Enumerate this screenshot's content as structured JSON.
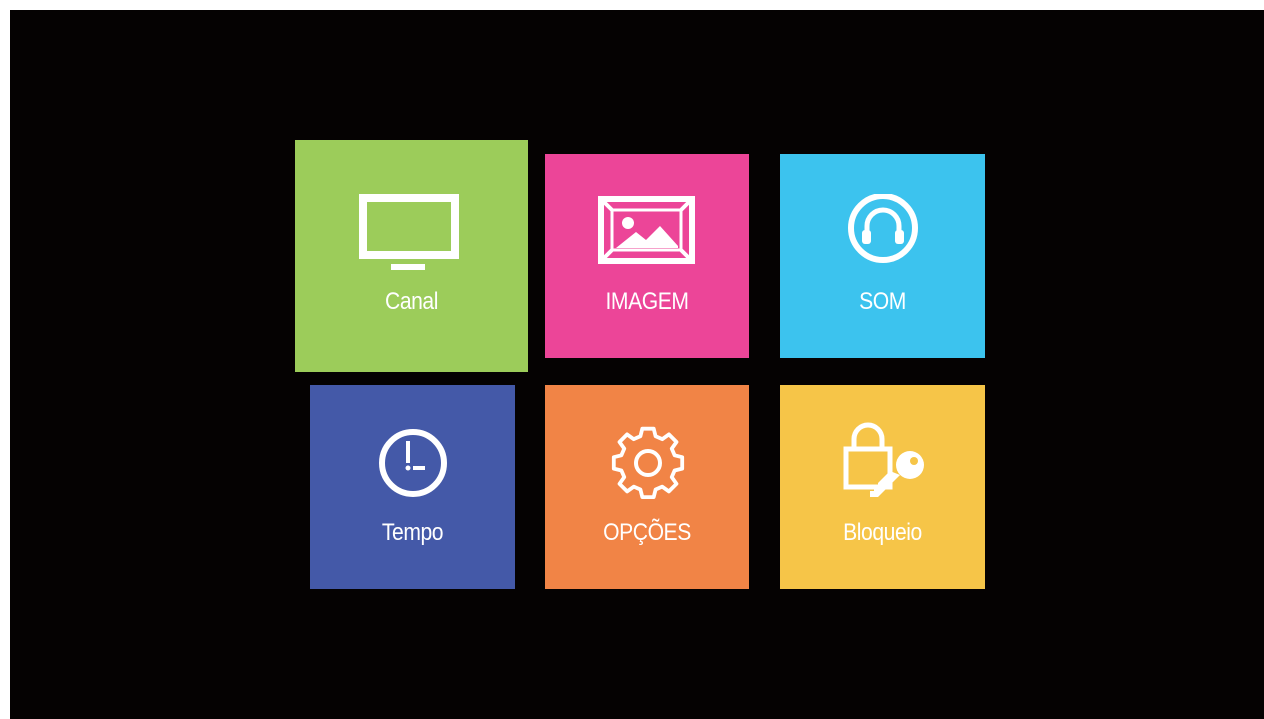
{
  "menu": {
    "tiles": [
      {
        "label": "Canal",
        "icon": "tv-icon",
        "color": "#9ccc5a"
      },
      {
        "label": "IMAGEM",
        "icon": "image-icon",
        "color": "#ec4598"
      },
      {
        "label": "SOM",
        "icon": "headphones-icon",
        "color": "#3cc3ee"
      },
      {
        "label": "Tempo",
        "icon": "clock-icon",
        "color": "#4459a8"
      },
      {
        "label": "OPÇÕES",
        "icon": "gear-icon",
        "color": "#f18446"
      },
      {
        "label": "Bloqueio",
        "icon": "lock-key-icon",
        "color": "#f6c548"
      }
    ],
    "selected": "Canal",
    "background": "#050202"
  }
}
